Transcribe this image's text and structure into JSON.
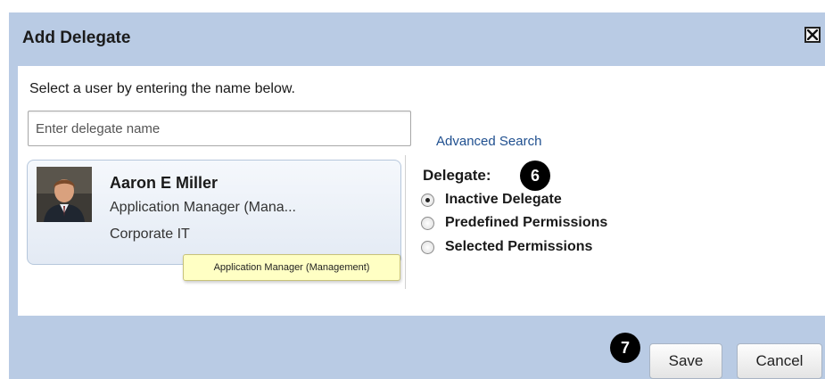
{
  "dialog": {
    "title": "Add Delegate",
    "close_icon": "close-icon"
  },
  "body": {
    "instruction": "Select a user by entering the name below.",
    "search": {
      "placeholder": "Enter delegate name",
      "value": ""
    },
    "advanced_search_label": "Advanced Search",
    "user": {
      "name": "Aaron E Miller",
      "title": "Application Manager (Mana...",
      "department": "Corporate IT",
      "tooltip": "Application Manager (Management)"
    },
    "delegate": {
      "label": "Delegate:",
      "step_badge": "6",
      "options": [
        {
          "label": "Inactive Delegate",
          "checked": true
        },
        {
          "label": "Predefined Permissions",
          "checked": false
        },
        {
          "label": "Selected Permissions",
          "checked": false
        }
      ]
    }
  },
  "footer": {
    "step_badge": "7",
    "save_label": "Save",
    "cancel_label": "Cancel"
  },
  "colors": {
    "frame": "#b9cbe4",
    "link": "#1f4f8f",
    "tooltip_bg": "#ffffc4"
  }
}
